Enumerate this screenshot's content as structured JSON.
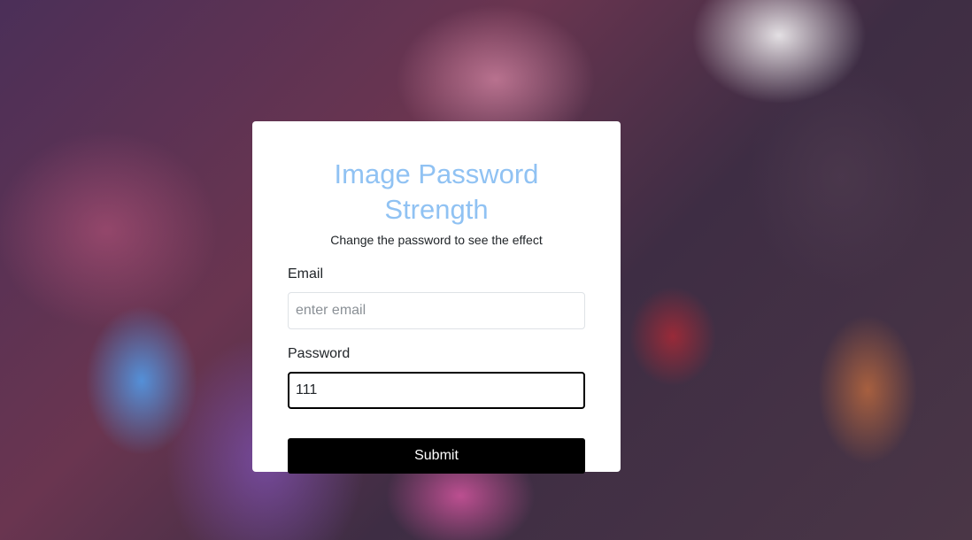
{
  "form": {
    "title": "Image Password Strength",
    "subtitle": "Change the password to see the effect",
    "email_label": "Email",
    "email_placeholder": "enter email",
    "email_value": "",
    "password_label": "Password",
    "password_value": "111",
    "submit_label": "Submit"
  },
  "colors": {
    "title": "#90c2f3",
    "button_bg": "#000000",
    "card_bg": "#ffffff"
  },
  "background": {
    "description_icon": "blurred-background-image"
  }
}
